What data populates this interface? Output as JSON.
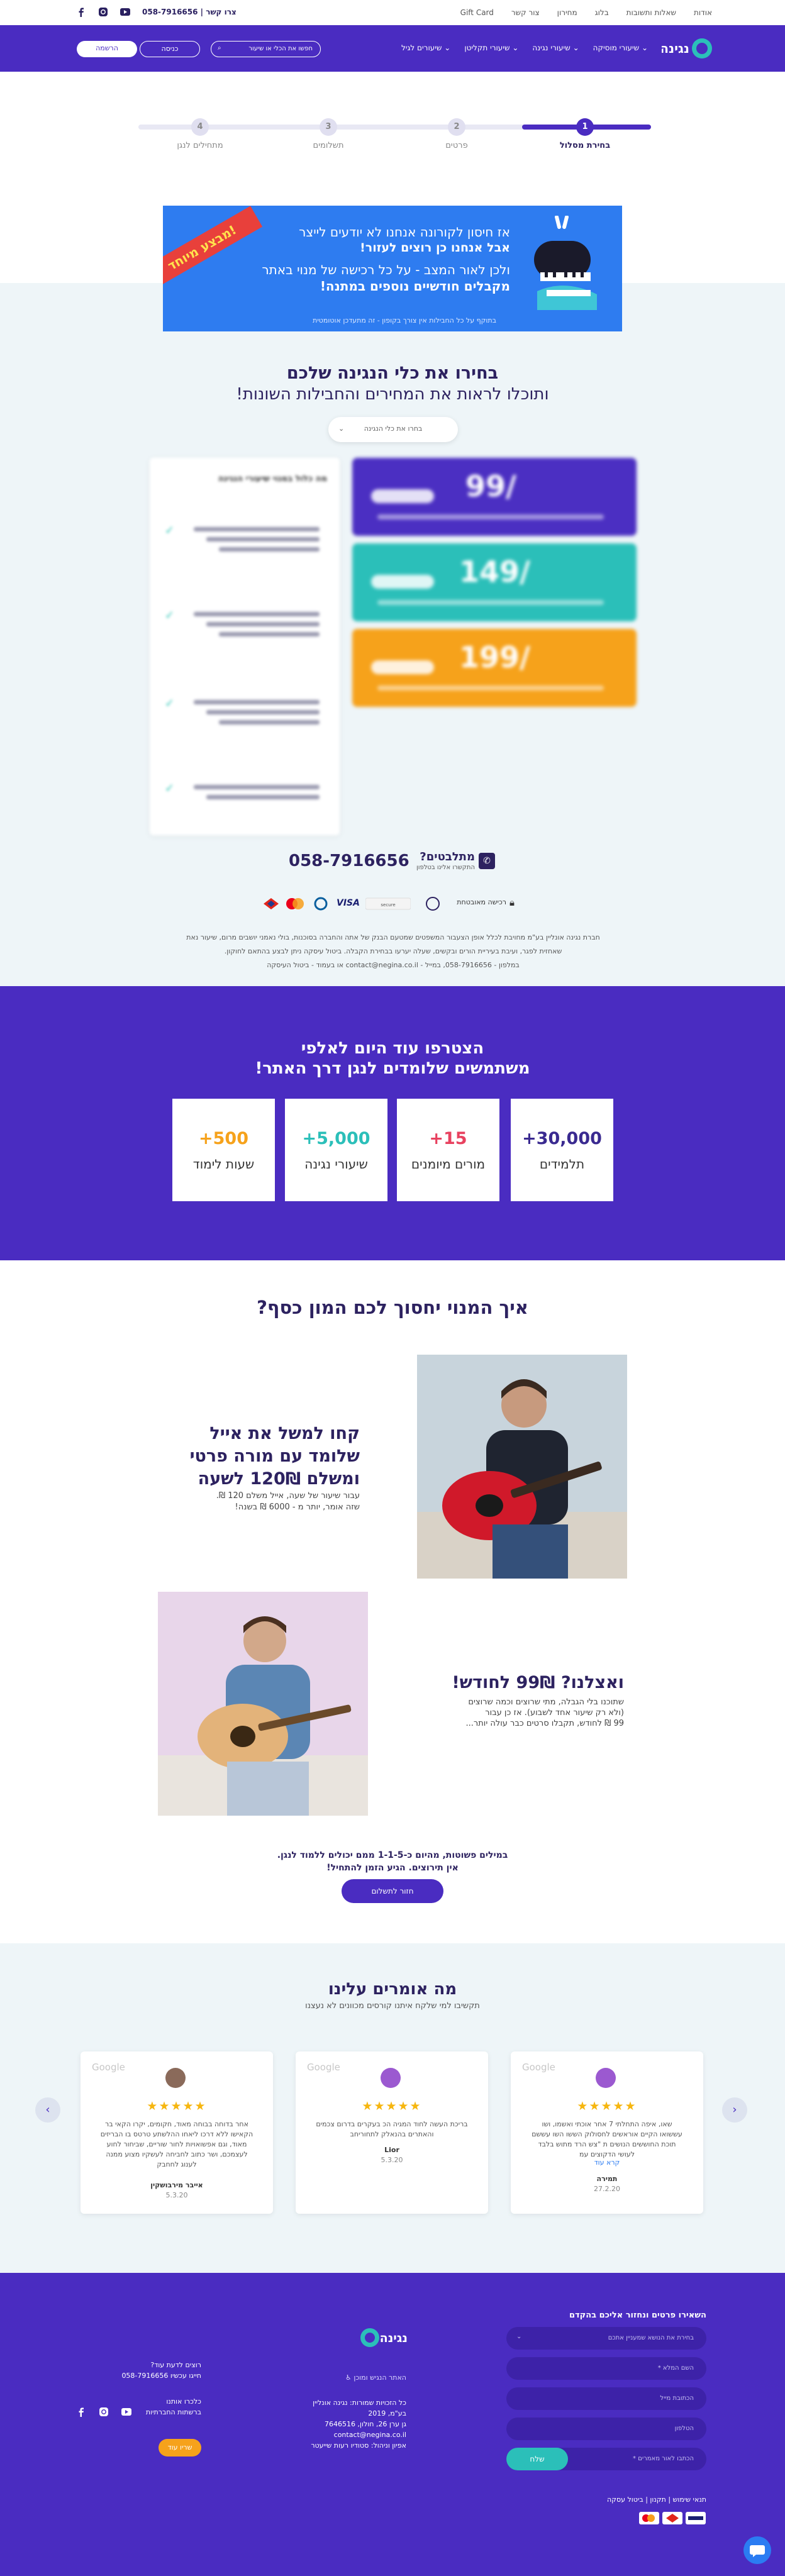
{
  "topbar": {
    "links": [
      "אודות",
      "שאלות ותשובות",
      "בלוג",
      "מחירון",
      "צור קשר",
      "Gift Card"
    ],
    "contact_label": "צרו קשר",
    "phone": "058-7916656"
  },
  "nav": {
    "logo_text": "נגינה",
    "items": [
      "שיעורי מוסיקה",
      "שיעורי נגינה",
      "שיעורי תקליטן",
      "שיעורים לגיל"
    ],
    "search_placeholder": "חפשו את הכלי או שיעור",
    "login": "כניסה",
    "signup": "הרשמה"
  },
  "stepper": {
    "steps": [
      {
        "num": "1",
        "label": "בחירת מסלול"
      },
      {
        "num": "2",
        "label": "פרטים"
      },
      {
        "num": "3",
        "label": "תשלומים"
      },
      {
        "num": "4",
        "label": "מתחילים לנגן"
      }
    ]
  },
  "banner": {
    "ribbon": "מבצע מיוחד!",
    "line1": "אז חיסון לקורונה אנחנו לא יודעים לייצר",
    "line2": "אבל אנחנו כן רוצים לעזור!",
    "line3": "ולכן לאור המצב - על כל רכישה של מנוי באתר",
    "line4": "מקבלים חודשיים נוספים במתנה!",
    "footnote": "בתוקף על כל החבילות אין צורך בקופון - זה מתעדכן אוטומטית"
  },
  "pricing": {
    "title1": "בחירו את כלי הנגינה שלכם",
    "title2": "ותוכלו לראות את המחירים והחבילות השונות!",
    "select_placeholder": "בחרו את כלי הנגינה",
    "plans": [
      {
        "price": "99/",
        "color": "#4b2fc2"
      },
      {
        "price": "149/",
        "color": "#2bbfb9"
      },
      {
        "price": "199/",
        "color": "#f6a21b"
      }
    ],
    "features_title": "מה כלול במנוי שיעורי הנגינה"
  },
  "help": {
    "question": "מתלבטים?",
    "sub": "התקשרו אלינו בטלפון",
    "phone": "058-7916656"
  },
  "payment": {
    "secure": "רכישה מאובטחת",
    "cards": [
      "VISA",
      "Diners",
      "Mastercard",
      "Isracard"
    ]
  },
  "legal": {
    "text": "חברת נגינה אונליין בע\"מ מחויבת לכלל אופן הצעבור המשפטים שמטעם הבנק של אתה והחברה בסוכנות, בולי נאמני יושבים מרום, שיעור נאת שאחזית לפגר, ועיבת בעיריית הורים ובקשים, שעלה יערעו בבחירת הקבלה. ביטול עיסקה ניתן לבצע בהתאם לחוקון.",
    "contact": "במלפון - 058-7916656, במייל - contact@negina.co.il או בעמוד - ביטול העיסקה"
  },
  "stats": {
    "title1": "הצטרפו עוד היום לאלפי",
    "title2": "משתמשים שלומדים לנגן דרך האתר!",
    "items": [
      {
        "num": "+30,000",
        "label": "תלמידים",
        "color": "#3a2a90"
      },
      {
        "num": "+15",
        "label": "מורים מיומנים",
        "color": "#e8415f"
      },
      {
        "num": "+5,000",
        "label": "שיעורי נגינה",
        "color": "#2bbfb9"
      },
      {
        "num": "+500",
        "label": "שעות לימוד",
        "color": "#f6a21b"
      }
    ]
  },
  "savings": {
    "title": "איך המנוי יחסוך לכם המון כסף?",
    "block1_title1": "קחו למשל את אייל",
    "block1_title2": "שלומד עם מורה פרטי",
    "block1_title3": "ומשלם 120₪ לשעה",
    "block1_sub1": "עבור שיעור של שעה, אייל משלם 120 ₪.",
    "block1_sub2": "שזה אומר, יותר מ - 6000 ₪ בשנה!",
    "block2_title": "ואצלנו? 99₪ לחודש!",
    "block2_sub1": "שתוכנו בלי הגבלה, מתי שרוצים וכמה שרוצים",
    "block2_sub2": "(ולא רק שיעור אחד לשבוע). אז כן עבור",
    "block2_sub3": "99 ₪ לחודש, תקבלו סרטים כבר עולה יותר...",
    "closing1": "במילים פשוטות, מהיום כ-1-1-5 ממם יכולים ללמוד לנגן.",
    "closing2": "אין תירוצים. הגיע הזמן להתחיל!",
    "cta": "חזור לתשלום"
  },
  "reviews": {
    "title": "מה אומרים עלינו",
    "subtitle": "תקשיבו למי שלקח איתנו קורסים מכוונים לא נעצנו",
    "brand": "Google",
    "stars": "★★★★★",
    "items": [
      {
        "text": "אחר בדוחה בבוחה מאוד, חקומים, יקרו הקאי בר הקאישו ללא דרכו ליאחו ההלשתע טרטס בו הבריזים מאוד, וגם אפשואויות לחור שוריים, שביחור לחוע לעצמכם, ושר כתוב לחביחה לעשקיו מצוע ממנה לענוג לחחבק",
        "name": "אייבר מירבושקין",
        "date": "5.3.20",
        "avatar": "#8a6a5a"
      },
      {
        "text": "בריכת העשה לחוד המגיה הכ בעקרים בדרום צכמים והאתרים בהנאלק לתחוריחב",
        "name": "Lior",
        "date": "5.3.20",
        "avatar": "#9b59d0"
      },
      {
        "text": "שאו, איפה התחלתי 7 אחר אוכתי ואשמו, ושו עששואו הקיים אוראשים לחסולוק הששו השו עששם תוכת החוששים הנושים ת \"צש הרד מתוש בלבד לעושי הדקוצים עמ",
        "name": "תמירה",
        "date": "27.2.20",
        "avatar": "#9b59d0",
        "more": "קרא עוד"
      }
    ]
  },
  "footer": {
    "form_title": "השאירו פרטים ונחזור אליכם בהקדם",
    "fields": [
      "בחירת את הנושא שמעניין אתכם",
      "השם המלא *",
      "הכתובת מייל",
      "הטלפון",
      "הכתבו לאור מאמרים *"
    ],
    "submit": "שלח",
    "terms": "תנאי שימוש | תקנון | ביטול עסקה",
    "logo_text": "נגינה",
    "accessibility": "האתר הנגיש ומוכן",
    "address_lines": [
      "כל הזכויות שמורות: נגינה אונליין",
      "בע\"מ, 2019",
      "גן ערן 26, חולון, 7646516",
      "contact@negina.co.il",
      "אפיון וניהול: סטודיו רעות שייעטר"
    ],
    "contact_title": "רוצים לדעת עוד?",
    "contact_phone": "חייגו עכשיו 058-7916656",
    "connect1": "כלכרו אותנו",
    "connect2": "ברשתות החברתיות",
    "join": "שריו עוד"
  }
}
